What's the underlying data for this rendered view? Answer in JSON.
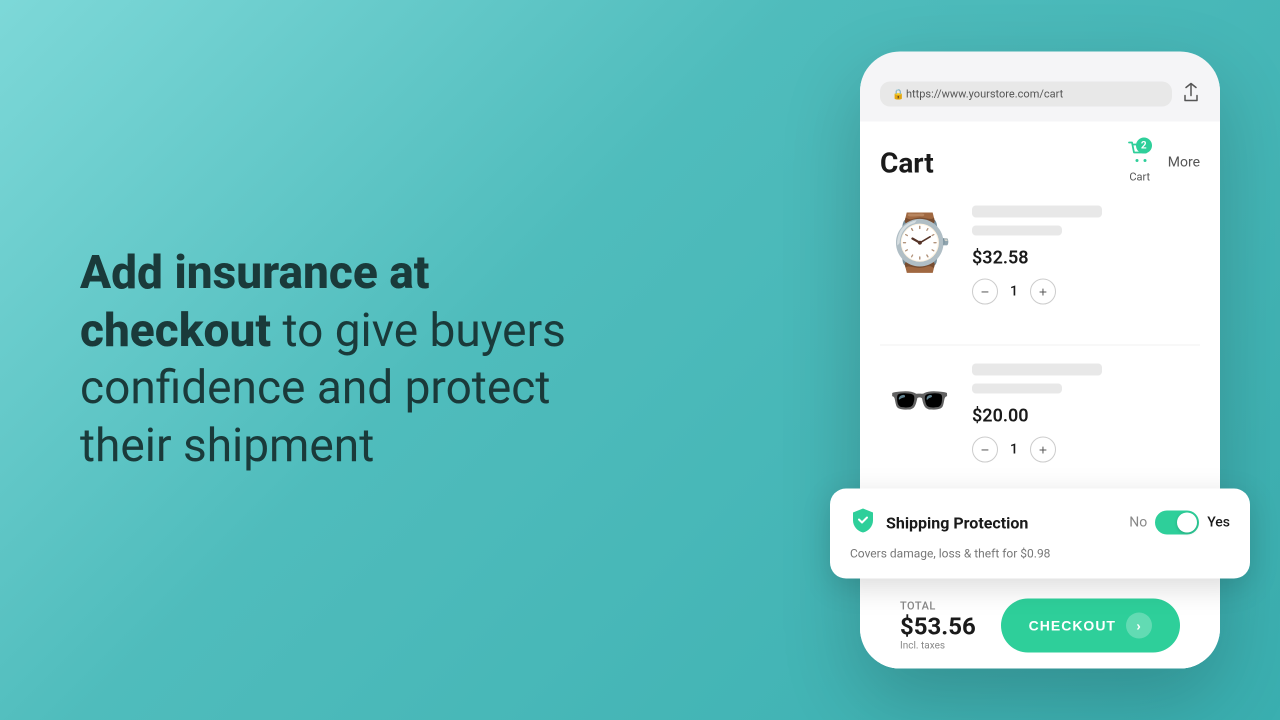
{
  "left": {
    "line1": "Add insurance at",
    "line2_bold": "checkout",
    "line2_rest": " to give buyers",
    "line3": "confidence and protect",
    "line4": "their shipment"
  },
  "phone": {
    "url": "https://www.yourstore.com/cart",
    "share_icon": "⬆",
    "lock_icon": "🔒",
    "cart_title": "Cart",
    "cart_badge": "2",
    "cart_nav_label": "Cart",
    "more_label": "More",
    "items": [
      {
        "emoji": "⌚",
        "price": "$32.58",
        "quantity": "1"
      },
      {
        "emoji": "🕶️",
        "price": "$20.00",
        "quantity": "1"
      }
    ],
    "shipping_protection": {
      "title": "Shipping Protection",
      "no_label": "No",
      "yes_label": "Yes",
      "description": "Covers damage, loss & theft for $0.98"
    },
    "footer": {
      "total_label": "TOTAL",
      "total_amount": "$53.56",
      "incl_taxes": "Incl. taxes",
      "checkout_label": "CHECKOUT"
    }
  }
}
